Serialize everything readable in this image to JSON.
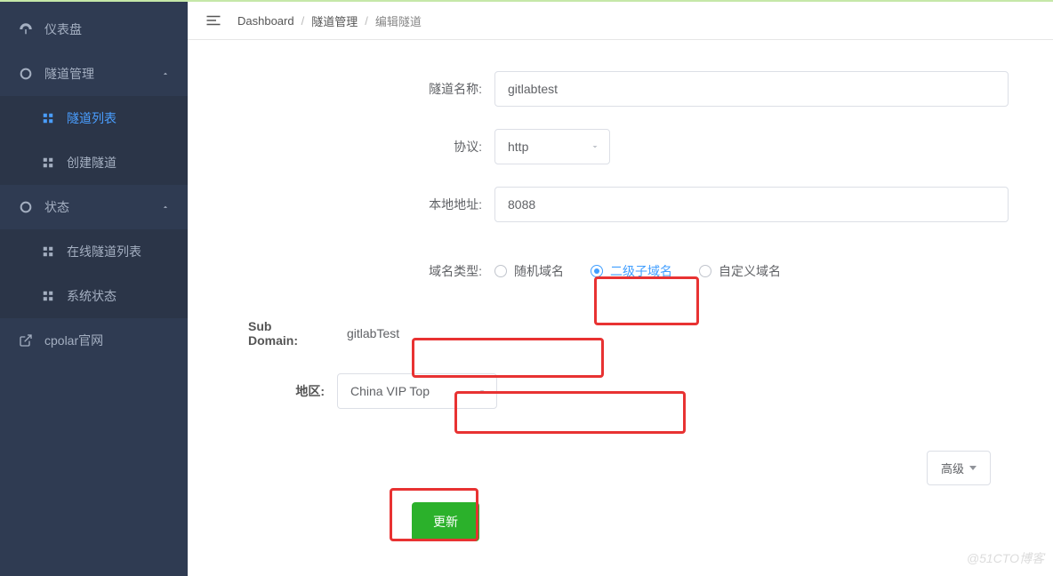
{
  "sidebar": {
    "items": [
      {
        "label": "仪表盘",
        "icon": "dashboard"
      },
      {
        "label": "隧道管理",
        "icon": "ring",
        "expandable": true,
        "children": [
          {
            "label": "隧道列表",
            "active": true
          },
          {
            "label": "创建隧道"
          }
        ]
      },
      {
        "label": "状态",
        "icon": "ring",
        "expandable": true,
        "children": [
          {
            "label": "在线隧道列表"
          },
          {
            "label": "系统状态"
          }
        ]
      },
      {
        "label": "cpolar官网",
        "icon": "external"
      }
    ]
  },
  "breadcrumb": {
    "root": "Dashboard",
    "mid": "隧道管理",
    "current": "编辑隧道"
  },
  "form": {
    "tunnel_name": {
      "label": "隧道名称:",
      "value": "gitlabtest"
    },
    "protocol": {
      "label": "协议:",
      "value": "http"
    },
    "local_addr": {
      "label": "本地地址:",
      "value": "8088"
    },
    "domain_type": {
      "label": "域名类型:",
      "options": [
        {
          "label": "随机域名",
          "checked": false
        },
        {
          "label": "二级子域名",
          "checked": true
        },
        {
          "label": "自定义域名",
          "checked": false
        }
      ]
    },
    "sub_domain": {
      "label": "Sub Domain:",
      "value": "gitlabTest"
    },
    "region": {
      "label": "地区:",
      "value": "China VIP Top"
    },
    "advanced_label": "高级",
    "submit_label": "更新"
  },
  "watermark": "@51CTO博客"
}
